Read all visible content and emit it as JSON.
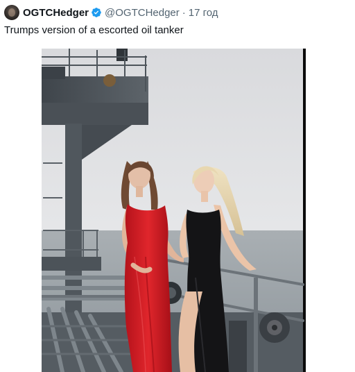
{
  "author": {
    "display_name": "OGTCHedger",
    "handle": "@OGTCHedger",
    "separator": "·",
    "timestamp": "17 год",
    "avatar_icon": "profile-avatar",
    "verified_icon": "verified-badge-icon",
    "verified_color": "#1d9bf0"
  },
  "tweet": {
    "text": "Trumps version of a escorted oil tanker"
  },
  "media": {
    "type": "photo",
    "subject": "photo-two-women-on-tanker-deck"
  }
}
